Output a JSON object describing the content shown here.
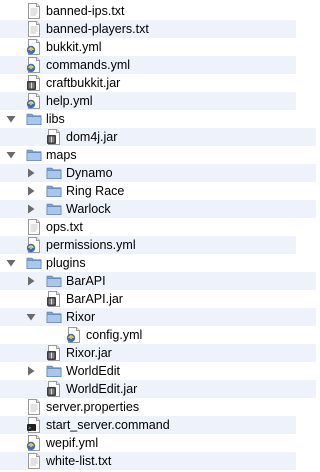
{
  "tree": {
    "rows": [
      {
        "label": "banned-ips.txt",
        "icon": "text-file-icon",
        "depth": 0,
        "disclosure": "none"
      },
      {
        "label": "banned-players.txt",
        "icon": "text-file-icon",
        "depth": 0,
        "disclosure": "none"
      },
      {
        "label": "bukkit.yml",
        "icon": "yml-file-icon",
        "depth": 0,
        "disclosure": "none"
      },
      {
        "label": "commands.yml",
        "icon": "yml-file-icon",
        "depth": 0,
        "disclosure": "none"
      },
      {
        "label": "craftbukkit.jar",
        "icon": "jar-file-icon",
        "depth": 0,
        "disclosure": "none"
      },
      {
        "label": "help.yml",
        "icon": "yml-file-icon",
        "depth": 0,
        "disclosure": "none"
      },
      {
        "label": "libs",
        "icon": "folder-icon",
        "depth": 0,
        "disclosure": "open"
      },
      {
        "label": "dom4j.jar",
        "icon": "jar-file-icon",
        "depth": 1,
        "disclosure": "none"
      },
      {
        "label": "maps",
        "icon": "folder-icon",
        "depth": 0,
        "disclosure": "open"
      },
      {
        "label": "Dynamo",
        "icon": "folder-icon",
        "depth": 1,
        "disclosure": "closed"
      },
      {
        "label": "Ring Race",
        "icon": "folder-icon",
        "depth": 1,
        "disclosure": "closed"
      },
      {
        "label": "Warlock",
        "icon": "folder-icon",
        "depth": 1,
        "disclosure": "closed"
      },
      {
        "label": "ops.txt",
        "icon": "text-file-icon",
        "depth": 0,
        "disclosure": "none"
      },
      {
        "label": "permissions.yml",
        "icon": "yml-file-icon",
        "depth": 0,
        "disclosure": "none"
      },
      {
        "label": "plugins",
        "icon": "folder-icon",
        "depth": 0,
        "disclosure": "open"
      },
      {
        "label": "BarAPI",
        "icon": "folder-icon",
        "depth": 1,
        "disclosure": "closed"
      },
      {
        "label": "BarAPI.jar",
        "icon": "jar-file-icon",
        "depth": 1,
        "disclosure": "none"
      },
      {
        "label": "Rixor",
        "icon": "folder-icon",
        "depth": 1,
        "disclosure": "open"
      },
      {
        "label": "config.yml",
        "icon": "yml-file-icon",
        "depth": 2,
        "disclosure": "none"
      },
      {
        "label": "Rixor.jar",
        "icon": "jar-file-icon",
        "depth": 1,
        "disclosure": "none"
      },
      {
        "label": "WorldEdit",
        "icon": "folder-icon",
        "depth": 1,
        "disclosure": "closed"
      },
      {
        "label": "WorldEdit.jar",
        "icon": "jar-file-icon",
        "depth": 1,
        "disclosure": "none"
      },
      {
        "label": "server.properties",
        "icon": "text-file-icon",
        "depth": 0,
        "disclosure": "none"
      },
      {
        "label": "start_server.command",
        "icon": "command-file-icon",
        "depth": 0,
        "disclosure": "none"
      },
      {
        "label": "wepif.yml",
        "icon": "yml-file-icon",
        "depth": 0,
        "disclosure": "none"
      },
      {
        "label": "white-list.txt",
        "icon": "text-file-icon",
        "depth": 0,
        "disclosure": "none"
      }
    ]
  },
  "colors": {
    "alt_row": "#eef3fb",
    "folder": "#7ea7d8",
    "disclosure": "#6b6b6b"
  }
}
